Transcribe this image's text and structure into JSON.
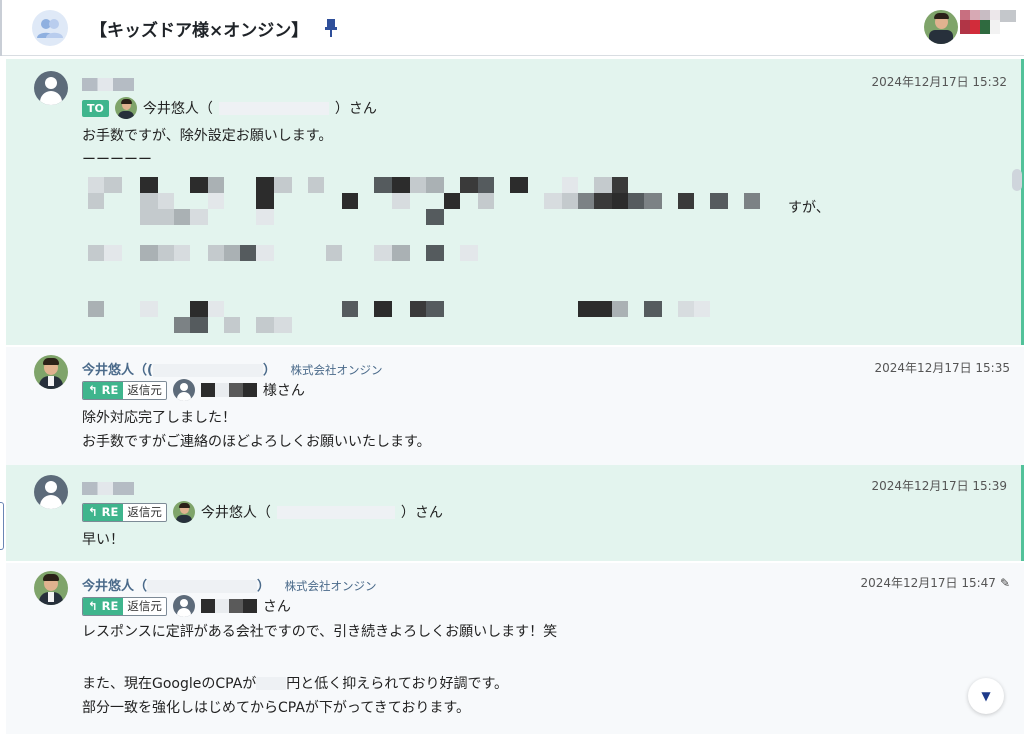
{
  "header": {
    "room_title": "【キッズドア様×オンジン】",
    "room_icon": "group-icon",
    "pin_icon": "pin-icon"
  },
  "messages": [
    {
      "kind": "mention",
      "timestamp": "2024年12月17日 15:32",
      "to_badge": "TO",
      "to_name": "今井悠人（",
      "to_suffix": "）さん",
      "lines": [
        "お手数ですが、除外設定お願いします。",
        "ーーーーー"
      ],
      "pixel_tail": "すが、"
    },
    {
      "kind": "normal",
      "sender": "今井悠人（(",
      "sender_close": "）",
      "org": "株式会社オンジン",
      "timestamp": "2024年12月17日 15:35",
      "re_label": "RE",
      "re_source": "返信元",
      "reply_suffix": "様さん",
      "lines": [
        "除外対応完了しました！",
        "お手数ですがご連絡のほどよろしくお願いいたします。"
      ]
    },
    {
      "kind": "mention",
      "timestamp": "2024年12月17日 15:39",
      "re_label": "RE",
      "re_source": "返信元",
      "reply_name": "今井悠人（",
      "reply_suffix": "）さん",
      "lines": [
        "早い！"
      ]
    },
    {
      "kind": "normal",
      "sender": "今井悠人（",
      "sender_close": "）",
      "org": "株式会社オンジン",
      "timestamp": "2024年12月17日 15:47",
      "re_label": "RE",
      "re_source": "返信元",
      "reply_suffix": "さん",
      "lines": [
        "レスポンスに定評がある会社ですので、引き続きよろしくお願いします！笑",
        "",
        "また、現在GoogleのCPAが",
        "円と低く抑えられており好調です。",
        "部分一致を強化しはじめてからCPAが下がってきております。"
      ]
    }
  ],
  "controls": {
    "scroll_down_label": "▼"
  },
  "colors": {
    "mention_bg": "#e3f4ee",
    "accent": "#3fb58d",
    "sender": "#4a6a8a"
  }
}
